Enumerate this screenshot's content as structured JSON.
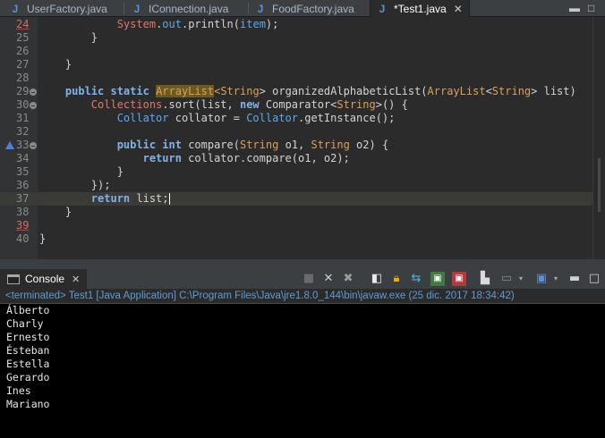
{
  "editor_tabs": [
    {
      "label": "UserFactory.java",
      "active": false
    },
    {
      "label": "IConnection.java",
      "active": false
    },
    {
      "label": "FoodFactory.java",
      "active": false
    },
    {
      "label": "*Test1.java",
      "active": true
    }
  ],
  "tab_close_glyph": "✕",
  "code_lines": [
    {
      "num": "24",
      "error": true,
      "segments": [
        {
          "t": "            "
        },
        {
          "t": "System",
          "c": "fld"
        },
        {
          "t": "."
        },
        {
          "t": "out",
          "c": "cls"
        },
        {
          "t": ".println("
        },
        {
          "t": "item",
          "c": "cls"
        },
        {
          "t": ");"
        }
      ]
    },
    {
      "num": "25",
      "segments": [
        {
          "t": "        }"
        }
      ]
    },
    {
      "num": "26",
      "segments": [
        {
          "t": ""
        }
      ]
    },
    {
      "num": "27",
      "segments": [
        {
          "t": "    }"
        }
      ]
    },
    {
      "num": "28",
      "segments": [
        {
          "t": ""
        }
      ]
    },
    {
      "num": "29",
      "fold": true,
      "segments": [
        {
          "t": "    "
        },
        {
          "t": "public static ",
          "c": "k"
        },
        {
          "t": "ArrayList",
          "c": "marked-t"
        },
        {
          "t": "<",
          "c": "t"
        },
        {
          "t": "String",
          "c": "t"
        },
        {
          "t": "> organizedAlphabeticList("
        },
        {
          "t": "ArrayList",
          "c": "t"
        },
        {
          "t": "<"
        },
        {
          "t": "String",
          "c": "t"
        },
        {
          "t": "> list)"
        }
      ]
    },
    {
      "num": "30",
      "fold": true,
      "segments": [
        {
          "t": "        "
        },
        {
          "t": "Collections",
          "c": "fld"
        },
        {
          "t": ".sort(list, "
        },
        {
          "t": "new ",
          "c": "k"
        },
        {
          "t": "Comparator<"
        },
        {
          "t": "String",
          "c": "t"
        },
        {
          "t": ">() {"
        }
      ]
    },
    {
      "num": "31",
      "segments": [
        {
          "t": "            "
        },
        {
          "t": "Collator",
          "c": "cls"
        },
        {
          "t": " collator = "
        },
        {
          "t": "Collator",
          "c": "cls"
        },
        {
          "t": ".getInstance();"
        }
      ]
    },
    {
      "num": "32",
      "segments": [
        {
          "t": ""
        }
      ]
    },
    {
      "num": "33",
      "fold": true,
      "override": true,
      "segments": [
        {
          "t": "            "
        },
        {
          "t": "public int ",
          "c": "k"
        },
        {
          "t": "compare("
        },
        {
          "t": "String",
          "c": "t"
        },
        {
          "t": " o1, "
        },
        {
          "t": "String",
          "c": "t"
        },
        {
          "t": " o2) {"
        }
      ]
    },
    {
      "num": "34",
      "segments": [
        {
          "t": "                "
        },
        {
          "t": "return ",
          "c": "k"
        },
        {
          "t": "collator.compare(o1, o2);"
        }
      ]
    },
    {
      "num": "35",
      "segments": [
        {
          "t": "            }"
        }
      ]
    },
    {
      "num": "36",
      "segments": [
        {
          "t": "        });"
        }
      ]
    },
    {
      "num": "37",
      "current": true,
      "segments": [
        {
          "t": "        "
        },
        {
          "t": "return ",
          "c": "k"
        },
        {
          "t": "list;"
        }
      ]
    },
    {
      "num": "38",
      "segments": [
        {
          "t": "    }"
        }
      ]
    },
    {
      "num": "39",
      "error": true,
      "segments": [
        {
          "t": ""
        }
      ]
    },
    {
      "num": "40",
      "segments": [
        {
          "t": "}"
        }
      ]
    }
  ],
  "console": {
    "tab_label": "Console",
    "status": "<terminated> Test1 [Java Application] C:\\Program Files\\Java\\jre1.8.0_144\\bin\\javaw.exe (25 dic. 2017 18:34:42)",
    "output": [
      "Álberto",
      "Charly",
      "Ernesto",
      "Ésteban",
      "Estella",
      "Gerardo",
      "Ines",
      "Mariano"
    ]
  },
  "colors": {
    "keyword": "#7fb3e8",
    "type": "#d9a05b",
    "field": "#e0786b",
    "terminated_status": "#5f9bd6",
    "console_bg": "#000000",
    "editor_bg": "#2b2b2b"
  }
}
